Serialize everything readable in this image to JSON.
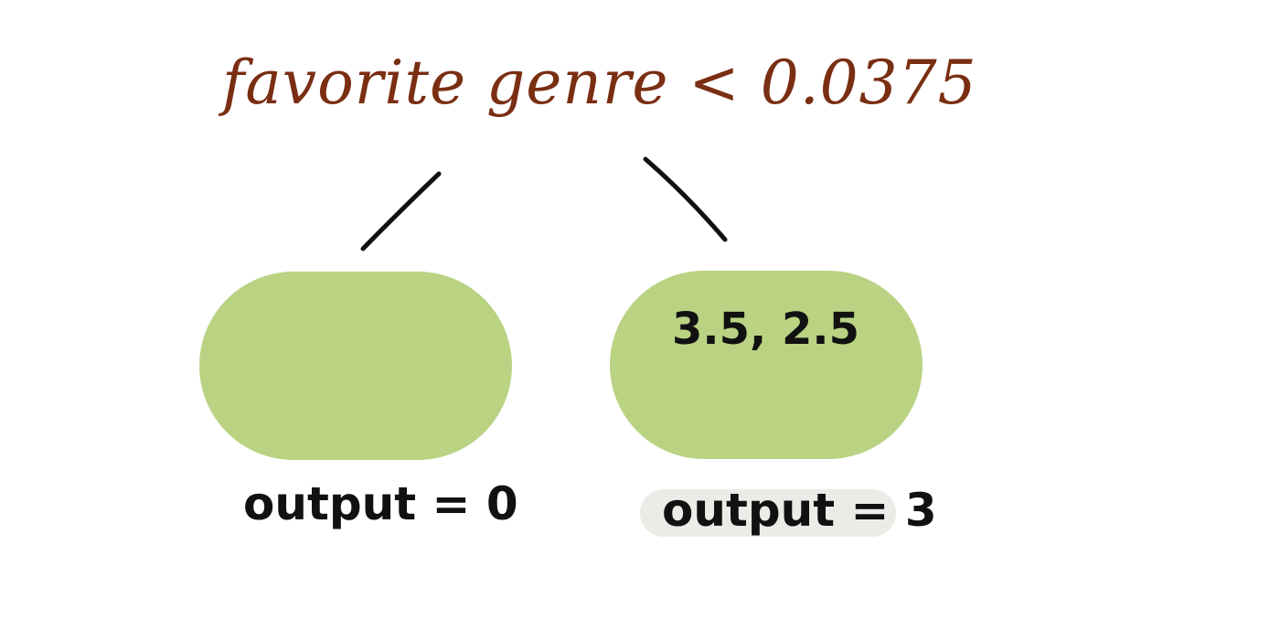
{
  "colors": {
    "condition_text": "#7a2e12",
    "leaf_fill": "#b9d383",
    "edge": "#111111",
    "output_highlight": "#ebebe8"
  },
  "root": {
    "condition": "favorite genre < 0.0375"
  },
  "leaves": [
    {
      "values": "",
      "output": "output = 0",
      "highlighted": false
    },
    {
      "values": "3.5, 2.5",
      "output": "output = 3",
      "highlighted": true
    }
  ]
}
